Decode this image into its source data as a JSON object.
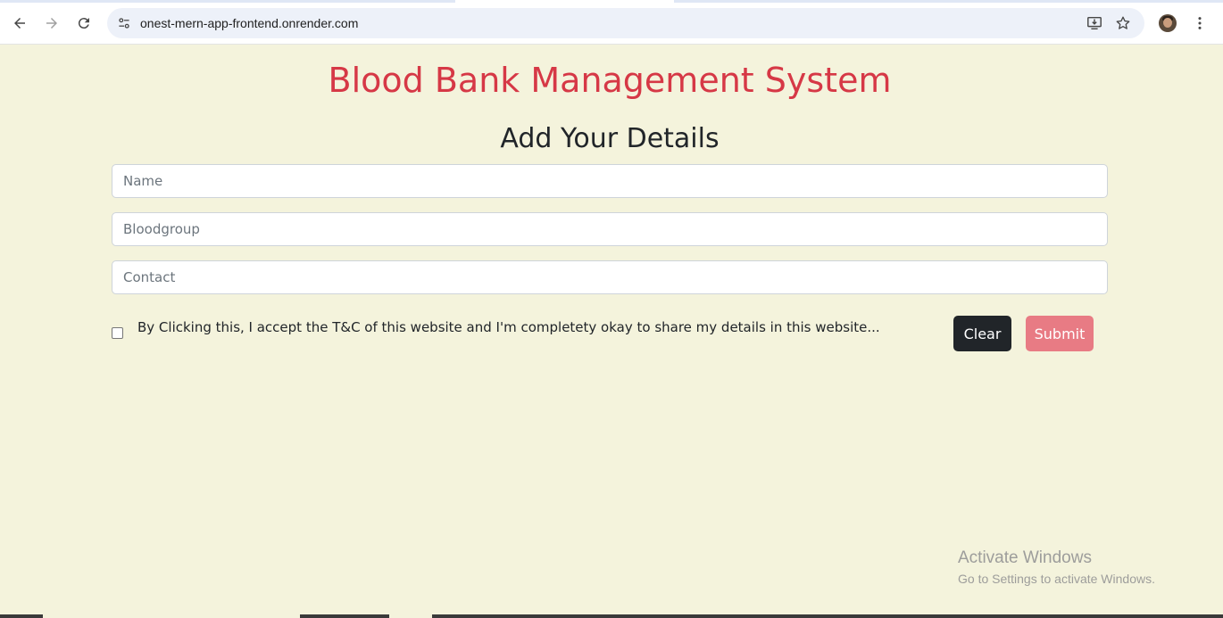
{
  "browser": {
    "url": "onest-mern-app-frontend.onrender.com",
    "icons": [
      "back-arrow-icon",
      "forward-arrow-icon",
      "reload-icon",
      "site-settings-icon",
      "install-app-icon",
      "bookmark-star-icon",
      "profile-avatar",
      "more-menu-icon"
    ]
  },
  "page": {
    "title": "Blood Bank Management System",
    "subtitle": "Add Your Details",
    "fields": {
      "name_placeholder": "Name",
      "bloodgroup_placeholder": "Bloodgroup",
      "contact_placeholder": "Contact",
      "name_value": "",
      "bloodgroup_value": "",
      "contact_value": ""
    },
    "terms_label": "By Clicking this, I accept the T&C of this website and I'm completety okay to share my details in this website...",
    "terms_checked": false,
    "clear_label": "Clear",
    "submit_label": "Submit"
  },
  "watermark": {
    "line1": "Activate Windows",
    "line2": "Go to Settings to activate Windows."
  },
  "colors": {
    "background": "#f4f3dc",
    "title": "#d63846",
    "clear_button": "#212529",
    "submit_button": "#e87b84"
  }
}
